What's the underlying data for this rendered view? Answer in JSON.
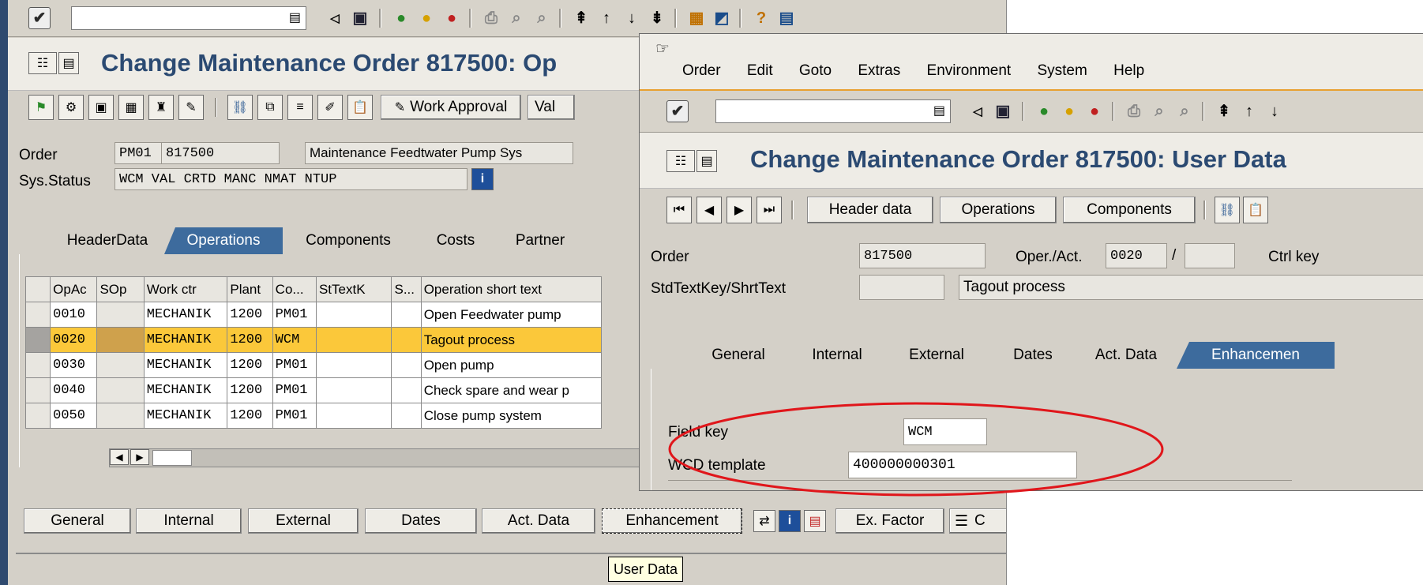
{
  "back_window": {
    "toolbar_icons": [
      "check-icon",
      "save-icon",
      "back-icon",
      "exit-icon",
      "cancel-icon",
      "print-icon",
      "find-icon",
      "find-next-icon",
      "first-page-icon",
      "prev-page-icon",
      "next-page-icon",
      "last-page-icon",
      "create-session-icon",
      "shortcut-icon",
      "help-icon",
      "layout-icon"
    ],
    "title": "Change Maintenance Order 817500: Op",
    "app_toolbar": {
      "work_approval": "Work Approval",
      "val": "Val"
    },
    "header": {
      "order_label": "Order",
      "order_type": "PM01",
      "order_number": "817500",
      "order_description": "Maintenance Feedtwater Pump Sys",
      "status_label": "Sys.Status",
      "status_value": "WCM  VAL  CRTD MANC NMAT NTUP"
    },
    "tabs": [
      "HeaderData",
      "Operations",
      "Components",
      "Costs",
      "Partner"
    ],
    "active_tab": "Operations",
    "table": {
      "columns": [
        "OpAc",
        "SOp",
        "Work ctr",
        "Plant",
        "Co...",
        "StTextK",
        "S...",
        "Operation short text"
      ],
      "rows": [
        {
          "op": "0010",
          "sop": "",
          "wc": "MECHANIK",
          "plant": "1200",
          "co": "PM01",
          "st": "",
          "s": "",
          "text": "Open Feedwater pump"
        },
        {
          "op": "0020",
          "sop": "",
          "wc": "MECHANIK",
          "plant": "1200",
          "co": "WCM",
          "st": "",
          "s": "",
          "text": "Tagout process"
        },
        {
          "op": "0030",
          "sop": "",
          "wc": "MECHANIK",
          "plant": "1200",
          "co": "PM01",
          "st": "",
          "s": "",
          "text": "Open pump"
        },
        {
          "op": "0040",
          "sop": "",
          "wc": "MECHANIK",
          "plant": "1200",
          "co": "PM01",
          "st": "",
          "s": "",
          "text": "Check spare and wear p"
        },
        {
          "op": "0050",
          "sop": "",
          "wc": "MECHANIK",
          "plant": "1200",
          "co": "PM01",
          "st": "",
          "s": "",
          "text": "Close pump system"
        }
      ]
    },
    "bottom_buttons": [
      "General",
      "Internal",
      "External",
      "Dates",
      "Act. Data",
      "Enhancement"
    ],
    "ex_factor": "Ex. Factor",
    "c_label": "C",
    "tooltip": "User Data"
  },
  "front_window": {
    "menu": [
      "Order",
      "Edit",
      "Goto",
      "Extras",
      "Environment",
      "System",
      "Help"
    ],
    "title": "Change Maintenance Order 817500: User Data",
    "nav_buttons": [
      "Header data",
      "Operations",
      "Components"
    ],
    "fields": {
      "order_label": "Order",
      "order_value": "817500",
      "operact_label": "Oper./Act.",
      "operact_value": "0020",
      "slash": "/",
      "ctrlkey_label": "Ctrl key",
      "stdtext_label": "StdTextKey/ShrtText",
      "stdtext_value": "Tagout process"
    },
    "tabs": [
      "General",
      "Internal",
      "External",
      "Dates",
      "Act. Data",
      "Enhancemen"
    ],
    "active_tab": "Enhancemen",
    "enh": {
      "field_key_label": "Field key",
      "field_key_value": "WCM",
      "wcd_label": "WCD template",
      "wcd_value": "400000000301"
    }
  },
  "colors": {
    "title": "#2b4a72",
    "tab_active": "#3d6b9d",
    "selected_row": "#fbc83a",
    "ellipse": "#e0161b"
  }
}
